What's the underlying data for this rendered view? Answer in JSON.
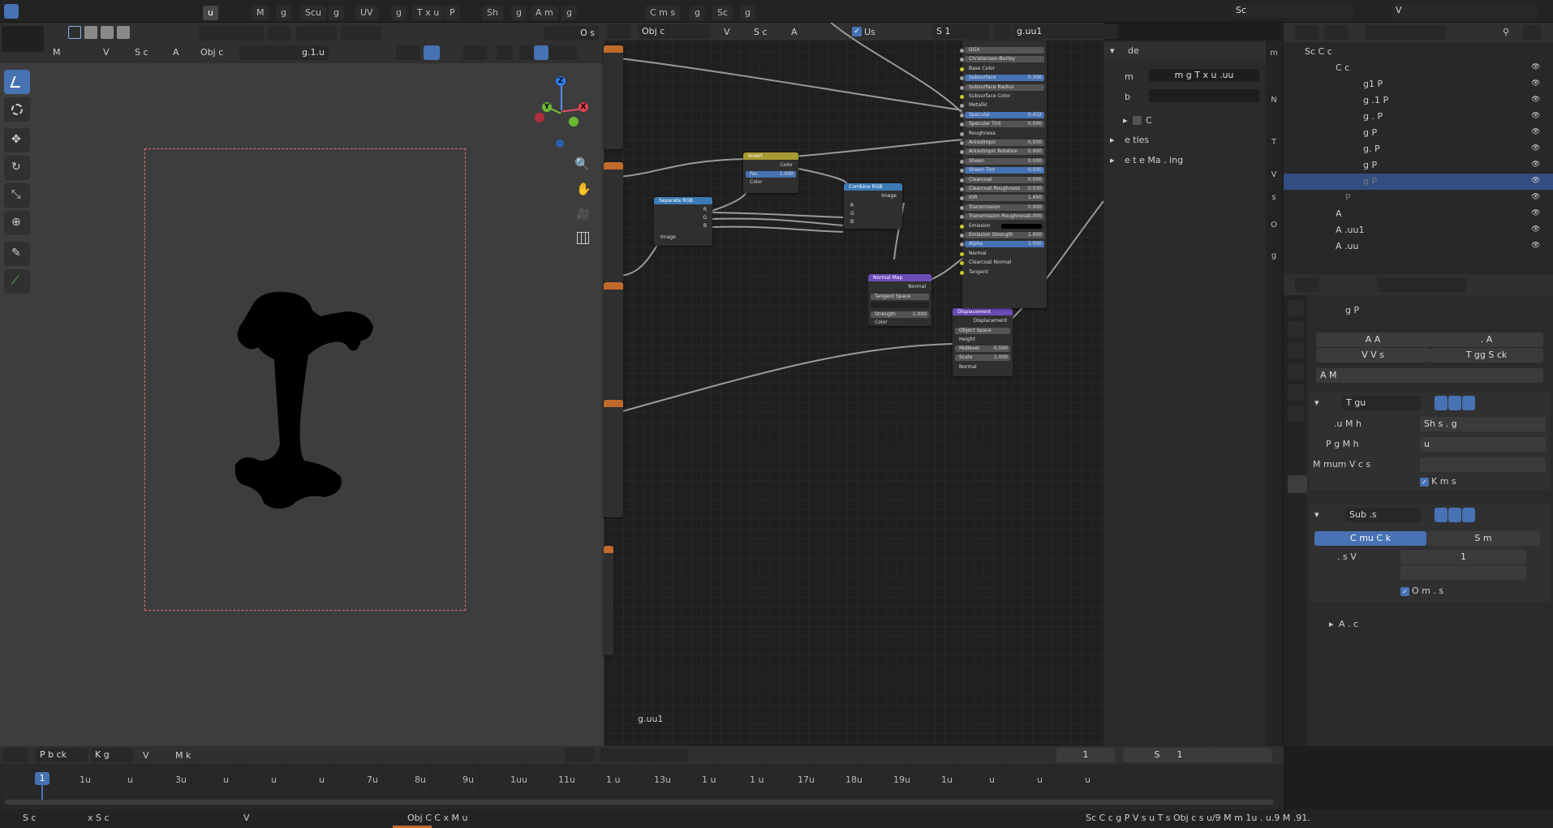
{
  "topbar": {
    "tabs": [
      "u",
      "M",
      "g",
      "Scu",
      "g",
      "UV",
      "g",
      "T x u",
      "P",
      "Sh",
      "g",
      "A m",
      "g",
      "C m s",
      "g",
      "Sc",
      "g"
    ],
    "scene_field": "Sc",
    "view_layer_field": "V"
  },
  "viewport": {
    "header_items": [
      "M",
      "V",
      "S c",
      "A",
      "Obj c"
    ],
    "mode_label": "O s",
    "mesh_label": "g.1.u",
    "colors": {
      "bg": "#3d3d3d",
      "frame": "#e07070"
    }
  },
  "node_editor": {
    "header_items": [
      "Obj c",
      "V",
      "S c",
      "A"
    ],
    "use_label": "Us",
    "slot_label": "S 1",
    "material_field": "g.uu1",
    "footer_label": "g.uu1",
    "nodes": {
      "invert": {
        "title": "Invert",
        "rows": [
          "Color",
          "Fac",
          "Color"
        ],
        "fac": "1.000"
      },
      "separate": {
        "title": "Separate RGB",
        "rows": [
          "R",
          "G",
          "B",
          "Image"
        ]
      },
      "combine": {
        "title": "Combine RGB",
        "rows": [
          "Image",
          "R",
          "G",
          "B"
        ]
      },
      "normal_map": {
        "title": "Normal Map",
        "rows": [
          "Normal",
          "Tangent Space",
          "Strength",
          "Color"
        ],
        "strength": "1.000"
      },
      "displacement": {
        "title": "Displacement",
        "rows": [
          "Displacement",
          "Object Space",
          "Height",
          "Midlevel",
          "Scale",
          "Normal"
        ],
        "midlevel": "0.500",
        "scale": "1.000"
      },
      "principled": {
        "rows": [
          {
            "label": "GGX",
            "value": "",
            "kind": "dropdown"
          },
          {
            "label": "Christensen-Burley",
            "value": "",
            "kind": "dropdown"
          },
          {
            "label": "Base Color",
            "value": "",
            "kind": "plain"
          },
          {
            "label": "Subsurface",
            "value": "0.306",
            "kind": "blue"
          },
          {
            "label": "Subsurface Radius",
            "value": "",
            "kind": "dropdown"
          },
          {
            "label": "Subsurface Color",
            "value": "",
            "kind": "plain"
          },
          {
            "label": "Metallic",
            "value": "",
            "kind": "plain"
          },
          {
            "label": "Specular",
            "value": "0.432",
            "kind": "blue"
          },
          {
            "label": "Specular Tint",
            "value": "0.000",
            "kind": "field"
          },
          {
            "label": "Roughness",
            "value": "",
            "kind": "plain"
          },
          {
            "label": "Anisotropic",
            "value": "0.000",
            "kind": "field"
          },
          {
            "label": "Anisotropic Rotation",
            "value": "0.000",
            "kind": "field"
          },
          {
            "label": "Sheen",
            "value": "0.000",
            "kind": "field"
          },
          {
            "label": "Sheen Tint",
            "value": "0.500",
            "kind": "blue"
          },
          {
            "label": "Clearcoat",
            "value": "0.000",
            "kind": "field"
          },
          {
            "label": "Clearcoat Roughness",
            "value": "0.030",
            "kind": "field"
          },
          {
            "label": "IOR",
            "value": "1.450",
            "kind": "field"
          },
          {
            "label": "Transmission",
            "value": "0.000",
            "kind": "field"
          },
          {
            "label": "Transmission Roughness",
            "value": "0.000",
            "kind": "field"
          },
          {
            "label": "Emission",
            "value": "",
            "kind": "plain"
          },
          {
            "label": "Emission Strength",
            "value": "1.000",
            "kind": "field"
          },
          {
            "label": "Alpha",
            "value": "1.000",
            "kind": "blue"
          },
          {
            "label": "Normal",
            "value": "",
            "kind": "plain"
          },
          {
            "label": "Clearcoat Normal",
            "value": "",
            "kind": "plain"
          },
          {
            "label": "Tangent",
            "value": "",
            "kind": "plain"
          }
        ]
      }
    }
  },
  "sidebar": {
    "section": "de",
    "name_label": "m",
    "name_value": "m g T x u .uu",
    "label_label": "b",
    "color_label": "C",
    "properties_label": "e ties",
    "texture_mapping_label": "e t e Ma . ing"
  },
  "outliner": {
    "scene": "Sc  C  c",
    "collection": "C  c",
    "items": [
      "g1  P",
      "g .1  P",
      "g .  P",
      "g  P",
      "g.  P",
      "g  P",
      "g  P",
      "P",
      "A",
      "A  .uu1",
      "A  .uu"
    ]
  },
  "properties": {
    "object_name": "g  P",
    "row1": [
      "A  A",
      ". A"
    ],
    "row2": [
      "V  V s",
      "T gg  S ck"
    ],
    "dropdown": "A  M",
    "modifier1": {
      "name": "T  gu",
      "fields": [
        {
          "label": ".u  M  h",
          "value": "Sh  s . g"
        },
        {
          "label": "P  g  M  h",
          "value": "u"
        },
        {
          "label": "M  mum V  c s",
          "value": ""
        }
      ],
      "checkbox": "K      m s"
    },
    "modifier2": {
      "name": "Sub .s",
      "tabs": [
        "C  mu C  k",
        "S m"
      ],
      "levels_label": ". s V",
      "levels_value": "1",
      "checkbox": "O  m . s",
      "advanced": "A . c"
    }
  },
  "timeline": {
    "header": [
      "P  b ck",
      "K  g",
      "V",
      "M k"
    ],
    "current_frame": "1",
    "start_label": "S",
    "start_value": "1",
    "frames": [
      "1",
      "1u",
      "u",
      "3u",
      "u",
      "u",
      "u",
      "7u",
      "8u",
      "9u",
      "1uu",
      "11u",
      "1 u",
      "13u",
      "1 u",
      "1 u",
      "17u",
      "18u",
      "19u",
      "1u",
      "u",
      "u",
      "u"
    ]
  },
  "statusbar": {
    "items": [
      "S c",
      "x S c",
      "V",
      "Obj  C C x M u"
    ],
    "right": "Sc  C c   g  P V s   u  T s   Obj c s u/9  M m   1u . u.9 M   .91."
  }
}
